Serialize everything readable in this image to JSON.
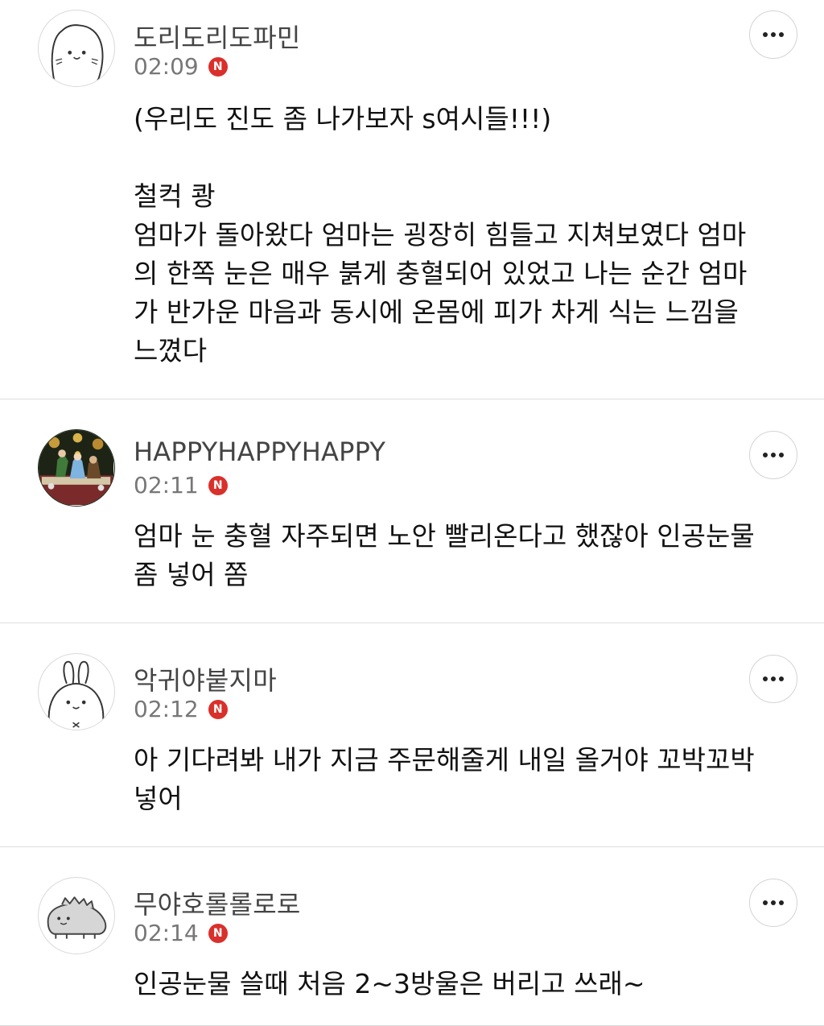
{
  "comments": [
    {
      "username": "도리도리도파민",
      "time": "02:09",
      "badge": "N",
      "avatar_icon": "cat-face-avatar",
      "lines_a": [
        "(우리도 진도 좀 나가보자 s여시들!!!)"
      ],
      "lines_b": [
        "철컥 쾅",
        "엄마가 돌아왔다 엄마는 굉장히 힘들고 지쳐보였다 엄마",
        "의 한쪽 눈은 매우 붉게 충혈되어 있었고 나는 순간 엄마",
        "가 반가운 마음과 동시에 온몸에 피가 차게 식는 느낌을",
        "느꼈다"
      ]
    },
    {
      "username": "HAPPYHAPPYHAPPY",
      "time": "02:11",
      "badge": "N",
      "avatar_icon": "tea-party-illustration-avatar",
      "lines_a": [
        "엄마 눈 충혈 자주되면 노안 빨리온다고 했잖아 인공눈물",
        "좀 넣어 쫌"
      ]
    },
    {
      "username": "악귀야붙지마",
      "time": "02:12",
      "badge": "N",
      "avatar_icon": "bunny-face-avatar",
      "lines_a": [
        "아 기다려봐 내가 지금 주문해줄게 내일 올거야 꼬박꼬박",
        "넣어"
      ]
    },
    {
      "username": "무야호롤롤로로",
      "time": "02:14",
      "badge": "N",
      "avatar_icon": "dinosaur-avatar",
      "lines_a": [
        "인공눈물 쓸때 처음 2~3방울은 버리고 쓰래~"
      ]
    }
  ],
  "more_icon": "more-dots-icon",
  "colors": {
    "badge": "#d9302b",
    "divider": "#dcdcdc",
    "username": "#444444",
    "time": "#777777"
  }
}
